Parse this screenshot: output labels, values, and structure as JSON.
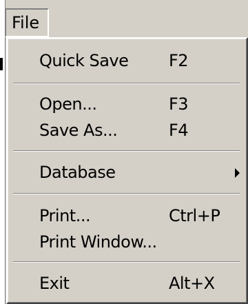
{
  "menubar": {
    "file_label": "File"
  },
  "menu": {
    "items": [
      {
        "label": "Quick Save",
        "shortcut": "F2"
      },
      {
        "label": "Open...",
        "shortcut": "F3"
      },
      {
        "label": "Save As...",
        "shortcut": "F4"
      },
      {
        "label": "Database",
        "shortcut": ""
      },
      {
        "label": "Print...",
        "shortcut": "Ctrl+P"
      },
      {
        "label": "Print Window...",
        "shortcut": ""
      },
      {
        "label": "Exit",
        "shortcut": "Alt+X"
      }
    ],
    "submenu_arrow_icon": "chevron-right-icon"
  },
  "colors": {
    "face": "#d4d0c8",
    "highlight": "#ffffff",
    "shadow": "#808080",
    "dark_shadow": "#404040"
  }
}
